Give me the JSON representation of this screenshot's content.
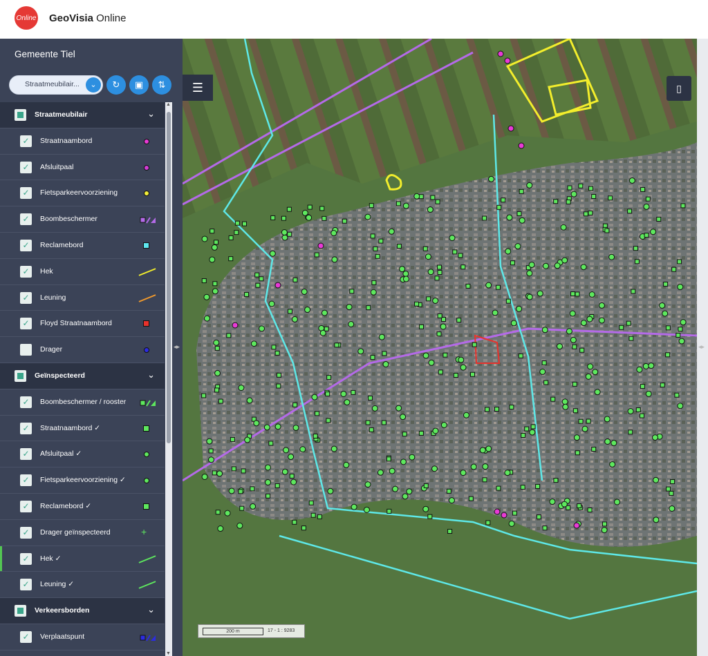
{
  "app": {
    "logo_text": "Online",
    "brand_bold": "GeoVisia",
    "brand_rest": " Online"
  },
  "sidebar": {
    "title": "Gemeente Tiel",
    "select_value": "Straatmeubilair...",
    "layers": [
      {
        "type": "group",
        "label": "Straatmeubilair"
      },
      {
        "type": "item",
        "label": "Straatnaambord",
        "symbol": "dot",
        "color": "#e83ad6"
      },
      {
        "type": "item",
        "label": "Afsluitpaal",
        "symbol": "dot",
        "color": "#d23cd6"
      },
      {
        "type": "item",
        "label": "Fietsparkeervoorziening",
        "symbol": "dot",
        "color": "#f2ee3a"
      },
      {
        "type": "item",
        "label": "Boombeschermer",
        "symbol": "multi",
        "color": "#b46ae8"
      },
      {
        "type": "item",
        "label": "Reclamebord",
        "symbol": "square",
        "color": "#5ee8f0"
      },
      {
        "type": "item",
        "label": "Hek",
        "symbol": "line",
        "color": "#f3ee2c"
      },
      {
        "type": "item",
        "label": "Leuning",
        "symbol": "line",
        "color": "#f29a2c"
      },
      {
        "type": "item",
        "label": "Floyd Straatnaambord",
        "symbol": "square",
        "color": "#e8322c"
      },
      {
        "type": "item",
        "label": "Drager",
        "symbol": "dot",
        "color": "#2c2ce0",
        "unchecked": true
      },
      {
        "type": "group",
        "label": "Geïnspecteerd"
      },
      {
        "type": "item",
        "label": "Boombeschermer / rooster",
        "symbol": "multi",
        "color": "#5ee85e"
      },
      {
        "type": "item",
        "label": "Straatnaambord ✓",
        "symbol": "square",
        "color": "#5ee85e"
      },
      {
        "type": "item",
        "label": "Afsluitpaal ✓",
        "symbol": "dot",
        "color": "#5ee85e"
      },
      {
        "type": "item",
        "label": "Fietsparkeervoorziening ✓",
        "symbol": "dot",
        "color": "#5ee85e"
      },
      {
        "type": "item",
        "label": "Reclamebord ✓",
        "symbol": "square",
        "color": "#5ee85e"
      },
      {
        "type": "item",
        "label": "Drager geïnspecteerd",
        "symbol": "plus",
        "color": "#5ee85e"
      },
      {
        "type": "item",
        "label": "Hek ✓",
        "symbol": "line",
        "color": "#5ee85e",
        "active": true
      },
      {
        "type": "item",
        "label": "Leuning ✓",
        "symbol": "line",
        "color": "#5ee85e"
      },
      {
        "type": "group",
        "label": "Verkeersborden"
      },
      {
        "type": "item",
        "label": "Verplaatspunt",
        "symbol": "multi",
        "color": "#2c2ce0"
      }
    ]
  },
  "map": {
    "scale_label": "200 m",
    "scale_ratio": "17 - 1 : 9283"
  }
}
